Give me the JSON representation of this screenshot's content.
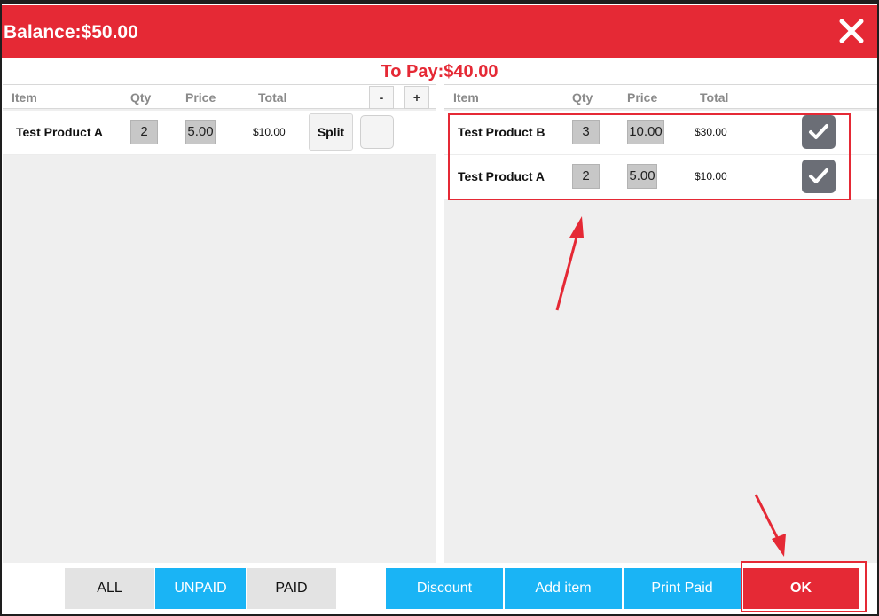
{
  "header": {
    "balance": "Balance:$50.00"
  },
  "to_pay": "To Pay:$40.00",
  "columns": {
    "item": "Item",
    "qty": "Qty",
    "price": "Price",
    "total": "Total"
  },
  "left": {
    "minus_label": "-",
    "plus_label": "+",
    "rows": [
      {
        "name": "Test Product A",
        "qty": "2",
        "price": "5.00",
        "total": "$10.00",
        "split_label": "Split"
      }
    ]
  },
  "right": {
    "rows": [
      {
        "name": "Test Product B",
        "qty": "3",
        "price": "10.00",
        "total": "$30.00"
      },
      {
        "name": "Test Product A",
        "qty": "2",
        "price": "5.00",
        "total": "$10.00"
      }
    ]
  },
  "footer": {
    "filter": [
      "ALL",
      "UNPAID",
      "PAID"
    ],
    "active_filter": "UNPAID",
    "actions": [
      "Discount",
      "Add item",
      "Print Paid"
    ],
    "ok": "OK"
  },
  "colors": {
    "header_red": "#e52935",
    "action_blue": "#1ab4f5",
    "check_grey": "#6b6e76"
  }
}
